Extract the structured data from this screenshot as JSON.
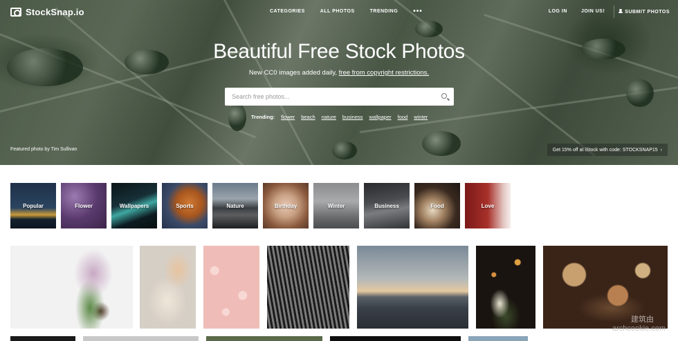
{
  "brand": {
    "name": "StockSnap.io"
  },
  "nav": {
    "center": [
      "CATEGORIES",
      "ALL PHOTOS",
      "TRENDING"
    ],
    "more": "•••",
    "login": "LOG IN",
    "join": "JOIN US!",
    "submit": "SUBMIT PHOTOS"
  },
  "hero": {
    "title": "Beautiful Free Stock Photos",
    "subtitle_prefix": "New CC0 images added daily,",
    "subtitle_link": "free from copyright restrictions.",
    "featured_prefix": "Featured photo by",
    "featured_author": "Tim Sullivan",
    "promo": "Get 15% off at iStock with code: STOCKSNAP15",
    "promo_arrow": "›"
  },
  "search": {
    "placeholder": "Search free photos...",
    "value": ""
  },
  "trending": {
    "label": "Trending:",
    "tags": [
      "flower",
      "beach",
      "nature",
      "business",
      "wallpaper",
      "food",
      "winter"
    ]
  },
  "categories": [
    {
      "label": "Popular"
    },
    {
      "label": "Flower"
    },
    {
      "label": "Wallpapers"
    },
    {
      "label": "Sports"
    },
    {
      "label": "Nature"
    },
    {
      "label": "Birthday"
    },
    {
      "label": "Winter"
    },
    {
      "label": "Business"
    },
    {
      "label": "Food"
    },
    {
      "label": "Love"
    }
  ],
  "colors": {
    "accent": "#ffffff",
    "hero_tint": "#5d6e58"
  },
  "watermark": {
    "line1": "建筑由",
    "line2": "archcookie.com"
  }
}
